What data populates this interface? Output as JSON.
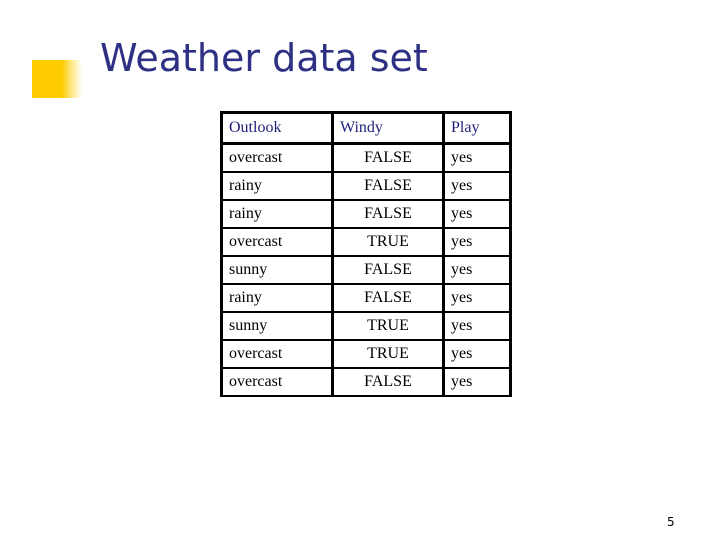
{
  "slide": {
    "title": "Weather data set",
    "page_number": "5",
    "bullet_icon": "yellow-square-bullet",
    "colors": {
      "title": "#2E3183",
      "header_text": "#1F1F7A",
      "bullet": "#FFCC00"
    }
  },
  "table": {
    "headers": [
      "Outlook",
      "Windy",
      "Play"
    ],
    "rows": [
      [
        "overcast",
        "FALSE",
        "yes"
      ],
      [
        "rainy",
        "FALSE",
        "yes"
      ],
      [
        "rainy",
        "FALSE",
        "yes"
      ],
      [
        "overcast",
        "TRUE",
        "yes"
      ],
      [
        "sunny",
        "FALSE",
        "yes"
      ],
      [
        "rainy",
        "FALSE",
        "yes"
      ],
      [
        "sunny",
        "TRUE",
        "yes"
      ],
      [
        "overcast",
        "TRUE",
        "yes"
      ],
      [
        "overcast",
        "FALSE",
        "yes"
      ]
    ]
  }
}
